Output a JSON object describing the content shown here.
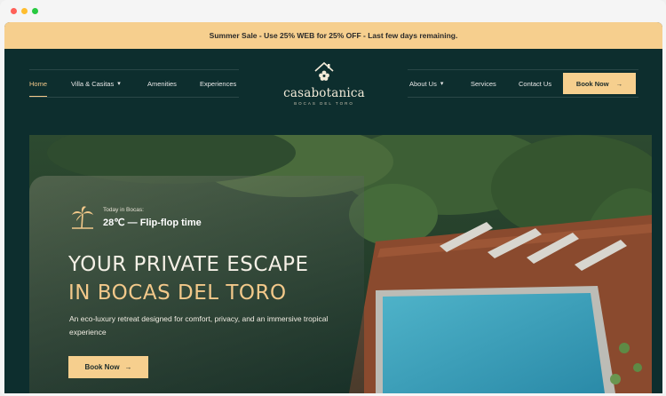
{
  "promo": {
    "text": "Summer Sale - Use 25% WEB for 25% OFF - Last few days remaining."
  },
  "nav": {
    "left": [
      {
        "label": "Home",
        "active": true
      },
      {
        "label": "Villa & Casitas",
        "dropdown": true
      },
      {
        "label": "Amenities"
      },
      {
        "label": "Experiences"
      }
    ],
    "right": [
      {
        "label": "About Us",
        "dropdown": true
      },
      {
        "label": "Services"
      },
      {
        "label": "Contact Us"
      }
    ],
    "book_label": "Book Now",
    "book_icon": "arrow-right-icon"
  },
  "logo": {
    "name": "casabotanica",
    "subtitle": "BOCAS DEL TORO"
  },
  "hero": {
    "weather_label": "Today in Bocas:",
    "weather_value": "28℃ — Flip-flop time",
    "headline_line1": "YOUR PRIVATE ESCAPE",
    "headline_line2": "IN BOCAS DEL TORO",
    "description": "An eco-luxury retreat designed for comfort, privacy, and an immersive tropical experience",
    "cta_label": "Book Now",
    "cta_icon": "arrow-right-icon"
  },
  "colors": {
    "background": "#0d2e2e",
    "accent": "#f6cf8e",
    "headline_accent": "#f2c88a"
  }
}
